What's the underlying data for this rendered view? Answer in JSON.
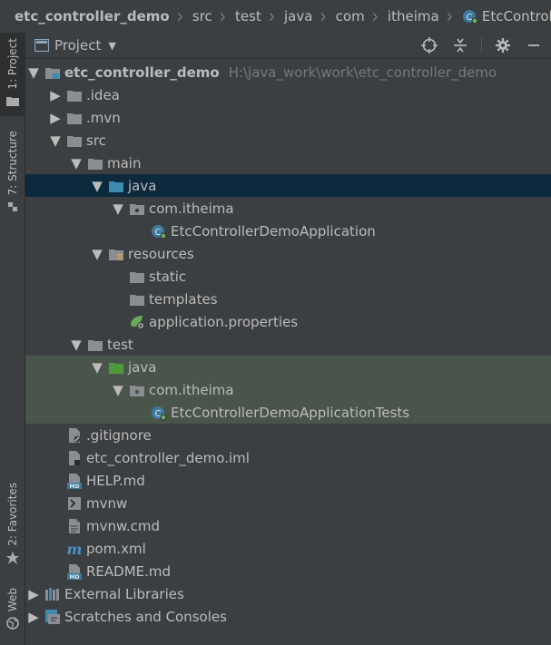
{
  "breadcrumb": [
    "etc_controller_demo",
    "src",
    "test",
    "java",
    "com",
    "itheima",
    "EtcControllerDem"
  ],
  "sidebar": {
    "project": "1: Project",
    "structure": "7: Structure",
    "favorites": "2: Favorites",
    "web": "Web"
  },
  "panel": {
    "title": "Project"
  },
  "tree": [
    {
      "label": "etc_controller_demo",
      "hint": "H:\\java_work\\work\\etc_controller_demo"
    },
    {
      "label": ".idea"
    },
    {
      "label": ".mvn"
    },
    {
      "label": "src"
    },
    {
      "label": "main"
    },
    {
      "label": "java"
    },
    {
      "label": "com.itheima"
    },
    {
      "label": "EtcControllerDemoApplication"
    },
    {
      "label": "resources"
    },
    {
      "label": "static"
    },
    {
      "label": "templates"
    },
    {
      "label": "application.properties"
    },
    {
      "label": "test"
    },
    {
      "label": "java"
    },
    {
      "label": "com.itheima"
    },
    {
      "label": "EtcControllerDemoApplicationTests"
    },
    {
      "label": ".gitignore"
    },
    {
      "label": "etc_controller_demo.iml"
    },
    {
      "label": "HELP.md"
    },
    {
      "label": "mvnw"
    },
    {
      "label": "mvnw.cmd"
    },
    {
      "label": "pom.xml"
    },
    {
      "label": "README.md"
    },
    {
      "label": "External Libraries"
    },
    {
      "label": "Scratches and Consoles"
    }
  ],
  "colors": {
    "selection": "#0d293e",
    "test_background": "#49544a",
    "source_folder": "#3f8bb0",
    "test_folder": "#4e9a3a"
  }
}
